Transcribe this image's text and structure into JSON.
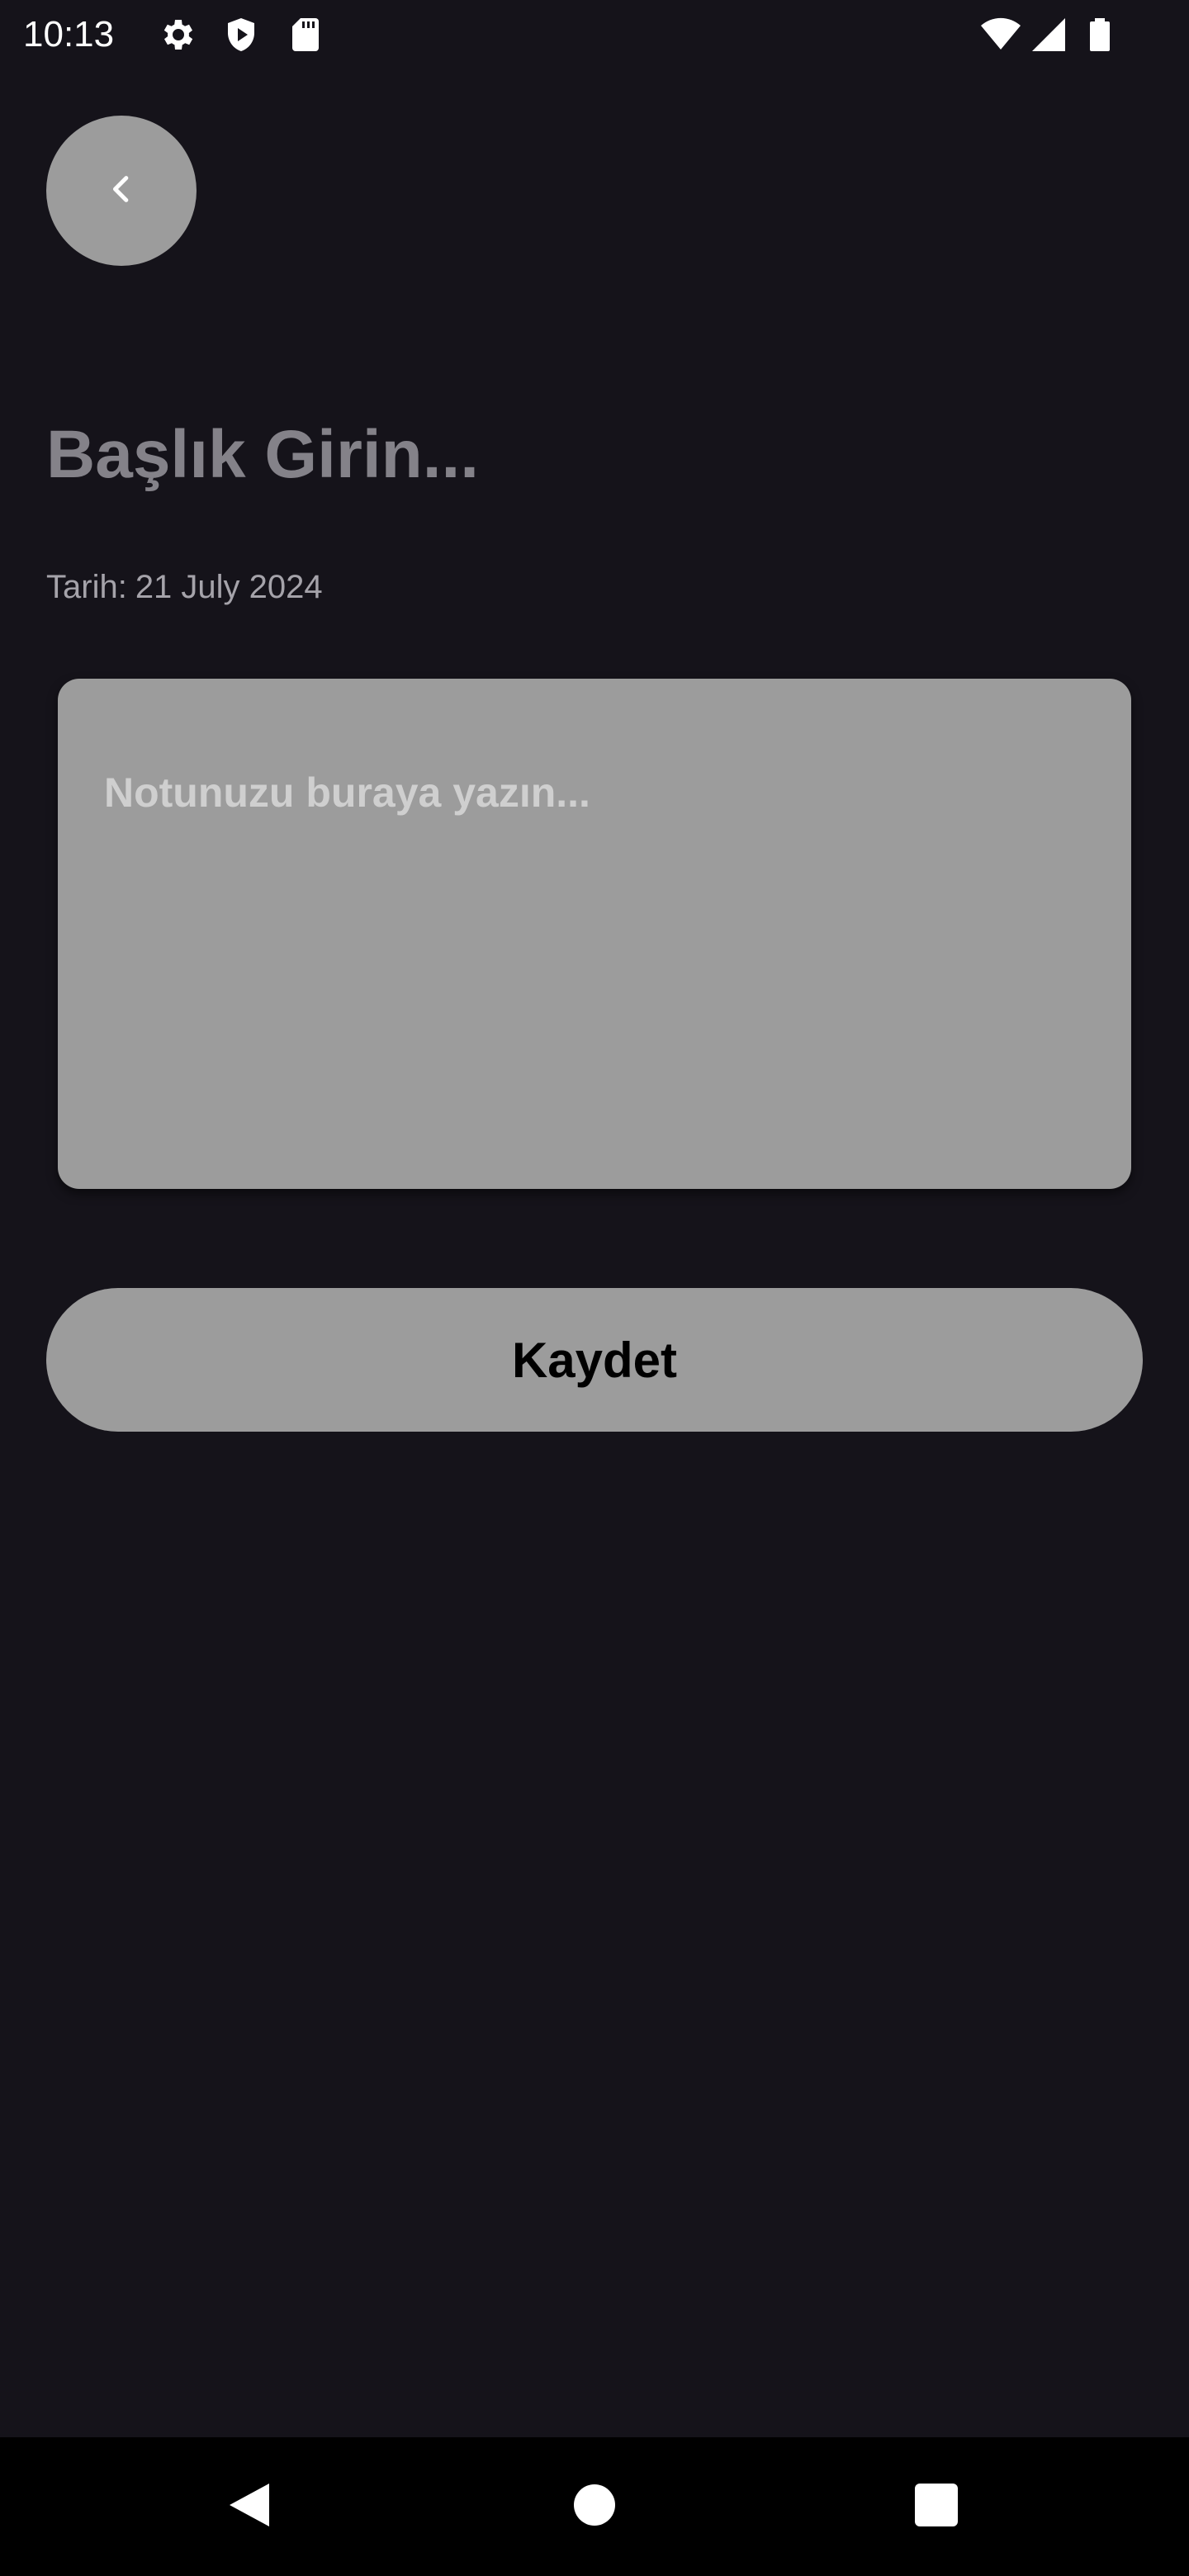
{
  "status_bar": {
    "time": "10:13",
    "icons": [
      "settings-icon",
      "shield-icon",
      "sd-card-icon",
      "wifi-icon",
      "signal-icon",
      "battery-icon"
    ]
  },
  "back_button": {
    "icon": "chevron-left-icon"
  },
  "title_field": {
    "placeholder": "Başlık Girin..."
  },
  "date": {
    "label": "Tarih:",
    "value": "21 July 2024"
  },
  "note_field": {
    "placeholder": "Notunuzu buraya yazın..."
  },
  "save_button": {
    "label": "Kaydet"
  },
  "nav_bar": {
    "icons": [
      "back-triangle-icon",
      "home-circle-icon",
      "recents-square-icon"
    ]
  },
  "colors": {
    "background": "#15131a",
    "surface": "#9c9c9c",
    "title_placeholder": "#848289",
    "date_text": "#a5a3aa"
  }
}
